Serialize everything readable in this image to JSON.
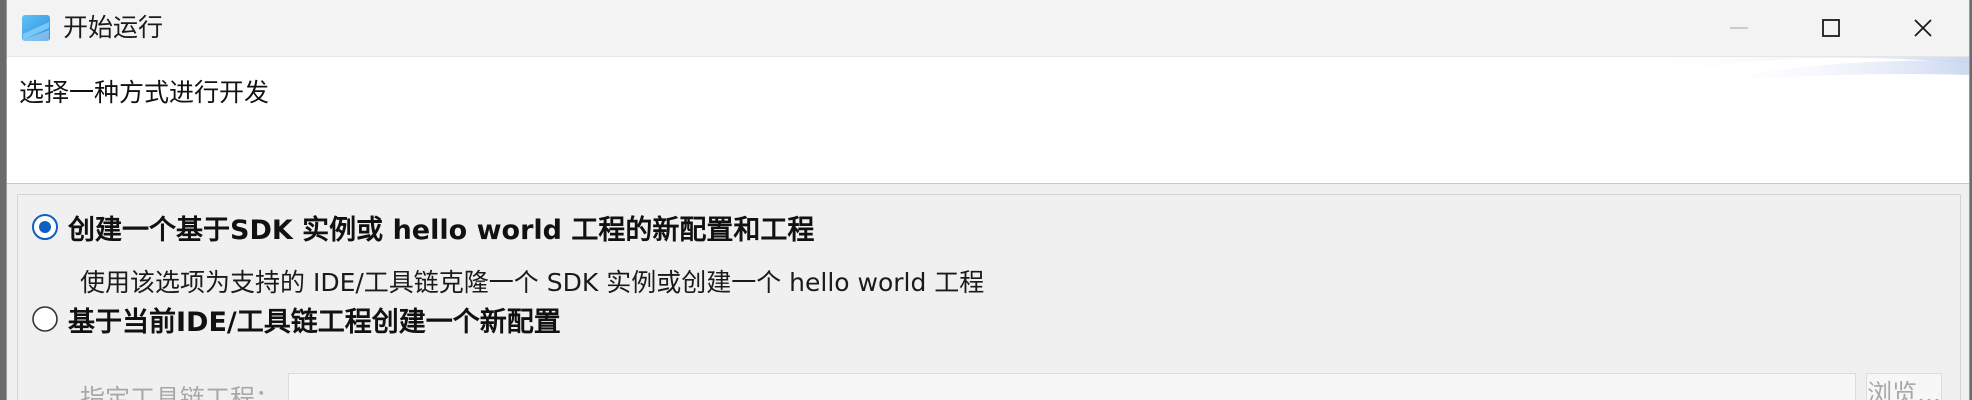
{
  "window": {
    "title": "开始运行",
    "controls": {
      "minimize_icon": "minimize-icon",
      "maximize_icon": "maximize-icon",
      "close_icon": "close-icon"
    }
  },
  "header": {
    "message": "选择一种方式进行开发"
  },
  "options": [
    {
      "label": "创建一个基于SDK 实例或 hello world 工程的新配置和工程",
      "description": "使用该选项为支持的 IDE/工具链克隆一个 SDK 实例或创建一个 hello world 工程",
      "selected": true
    },
    {
      "label": "基于当前IDE/工具链工程创建一个新配置",
      "selected": false,
      "field_label": "指定工具链工程：",
      "field_value": "",
      "browse_label": "浏览..."
    }
  ],
  "colors": {
    "radio_selected": "#0f5fc2",
    "disabled_text": "#a8a8a8"
  }
}
